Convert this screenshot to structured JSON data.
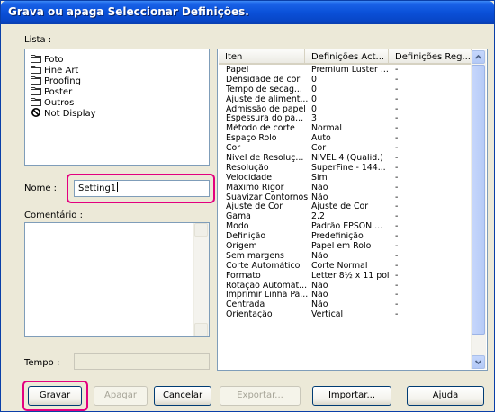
{
  "window": {
    "title": "Grava ou apaga Seleccionar Definições."
  },
  "lista": {
    "label": "Lista :",
    "items": [
      {
        "label": "Foto",
        "icon": "folder-icon"
      },
      {
        "label": "Fine Art",
        "icon": "folder-icon"
      },
      {
        "label": "Proofing",
        "icon": "folder-icon"
      },
      {
        "label": "Poster",
        "icon": "folder-icon"
      },
      {
        "label": "Outros",
        "icon": "folder-icon"
      },
      {
        "label": "Not Display",
        "icon": "no-entry-icon"
      }
    ]
  },
  "nome": {
    "label": "Nome :",
    "value": "Setting1"
  },
  "comentario": {
    "label": "Comentário :",
    "value": ""
  },
  "tempo": {
    "label": "Tempo :",
    "value": ""
  },
  "table": {
    "headers": [
      "Iten",
      "Definições Act...",
      "Definições Reg..."
    ],
    "rows": [
      [
        "Papel",
        "Premium Luster ...",
        "-"
      ],
      [
        "Densidade de cor",
        "0",
        "-"
      ],
      [
        "Tempo de secag...",
        "0",
        "-"
      ],
      [
        "Ajuste de aliment...",
        "0",
        "-"
      ],
      [
        "Admissão de papel",
        "0",
        "-"
      ],
      [
        "Espessura do pa...",
        "3",
        "-"
      ],
      [
        "Método de corte",
        "Normal",
        "-"
      ],
      [
        "Espaço Rolo",
        "Auto",
        "-"
      ],
      [
        "Cor",
        "Cor",
        "-"
      ],
      [
        "Nível de Resoluç...",
        "NÍVEL 4 (Qualid.)",
        "-"
      ],
      [
        "Resolução",
        "SuperFine - 144...",
        "-"
      ],
      [
        "Velocidade",
        "Sim",
        "-"
      ],
      [
        "Máximo Rigor",
        "Não",
        "-"
      ],
      [
        "Suavizar Contornos",
        "Não",
        "-"
      ],
      [
        "Ajuste de Cor",
        "Ajuste de Cor",
        "-"
      ],
      [
        "Gama",
        "2.2",
        "-"
      ],
      [
        "Modo",
        "Padrão EPSON ...",
        "-"
      ],
      [
        "Definição",
        "Predefinição",
        "-"
      ],
      [
        "Origem",
        "Papel em Rolo",
        "-"
      ],
      [
        "Sem margens",
        "Não",
        "-"
      ],
      [
        "Corte Automático",
        "Corte Normal",
        "-"
      ],
      [
        "Formato",
        "Letter 8½ x 11 pol",
        "-"
      ],
      [
        "Rotação Automát...",
        "Não",
        "-"
      ],
      [
        "Imprimir Linha Pá...",
        "Não",
        "-"
      ],
      [
        "Centrada",
        "Não",
        "-"
      ],
      [
        "Orientação",
        "Vertical",
        "-"
      ]
    ]
  },
  "buttons": {
    "gravar": "Gravar",
    "apagar": "Apagar",
    "cancelar": "Cancelar",
    "exportar": "Exportar...",
    "importar": "Importar...",
    "ajuda": "Ajuda"
  },
  "colors": {
    "highlight": "#e3007f",
    "titlebar": "#0a50d8"
  }
}
